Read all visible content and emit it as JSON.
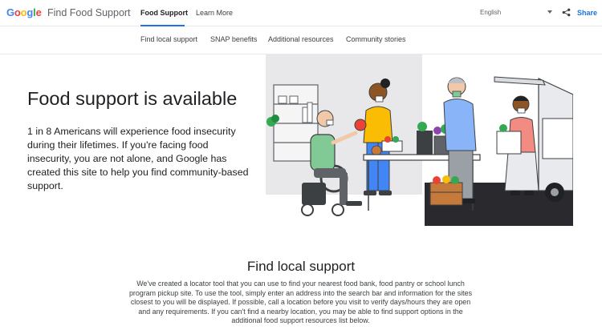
{
  "header": {
    "logo_letters": [
      "G",
      "o",
      "o",
      "g",
      "l",
      "e"
    ],
    "logo_colors": [
      "#4285f4",
      "#ea4335",
      "#fbbc05",
      "#4285f4",
      "#34a853",
      "#ea4335"
    ],
    "site_title": "Find Food Support",
    "nav": [
      {
        "label": "Food Support",
        "active": true
      },
      {
        "label": "Learn More",
        "active": false
      }
    ],
    "language": "English",
    "share_label": "Share",
    "accent_color": "#1a73e8"
  },
  "subnav": {
    "items": [
      "Find local support",
      "SNAP benefits",
      "Additional resources",
      "Community stories"
    ]
  },
  "hero": {
    "title": "Food support is available",
    "body": "1 in 8 Americans will experience food insecurity during their lifetimes. If you're facing food insecurity, you are not alone, and Google has created this site to help you find community-based support."
  },
  "find_local": {
    "title": "Find local support",
    "body": "We've created a locator tool that you can use to find your nearest food bank, food pantry or school lunch program pickup site. To use the tool, simply enter an address into the search bar and information for the sites closest to you will be displayed. If possible, call a location before you visit to verify days/hours they are open and any requirements. If you can't find a nearby location, you may be able to find support options in the additional food support resources list below."
  }
}
